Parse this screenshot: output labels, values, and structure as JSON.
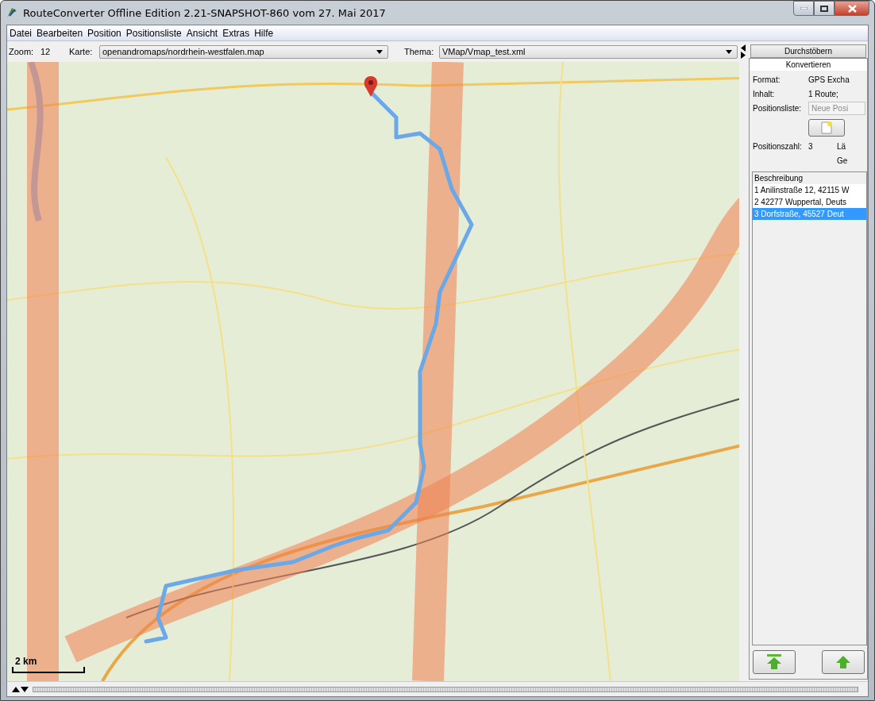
{
  "window": {
    "title": "RouteConverter Offline Edition 2.21-SNAPSHOT-860 vom 27. Mai 2017"
  },
  "menu": [
    "Datei",
    "Bearbeiten",
    "Position",
    "Positionsliste",
    "Ansicht",
    "Extras",
    "Hilfe"
  ],
  "toolbar": {
    "zoom_label": "Zoom:",
    "zoom_value": "12",
    "map_label": "Karte:",
    "map_value": "openandromaps/nordrhein-westfalen.map",
    "theme_label": "Thema:",
    "theme_value": "VMap/Vmap_test.xml"
  },
  "map": {
    "scale": "2 km"
  },
  "tabs": [
    {
      "label": "Durchstöbern",
      "selected": false
    },
    {
      "label": "Konvertieren",
      "selected": true
    }
  ],
  "details": {
    "format_label": "Format:",
    "format_value": "GPS Excha",
    "content_label": "Inhalt:",
    "content_value": "1 Route;",
    "list_label": "Positionsliste:",
    "list_field": {
      "value": "Neue Posi",
      "disabled": true
    },
    "count_label": "Positionszahl:",
    "count_value": "3",
    "column_3": "Lä",
    "column_4": "Ge"
  },
  "positions": {
    "header": "Beschreibung",
    "rows": [
      {
        "text": "1 Anilinstraße 12, 42115 W",
        "selected": false
      },
      {
        "text": "2 42277 Wuppertal, Deuts",
        "selected": false
      },
      {
        "text": "3 Dorfstraße, 45527 Deut",
        "selected": true
      }
    ]
  }
}
